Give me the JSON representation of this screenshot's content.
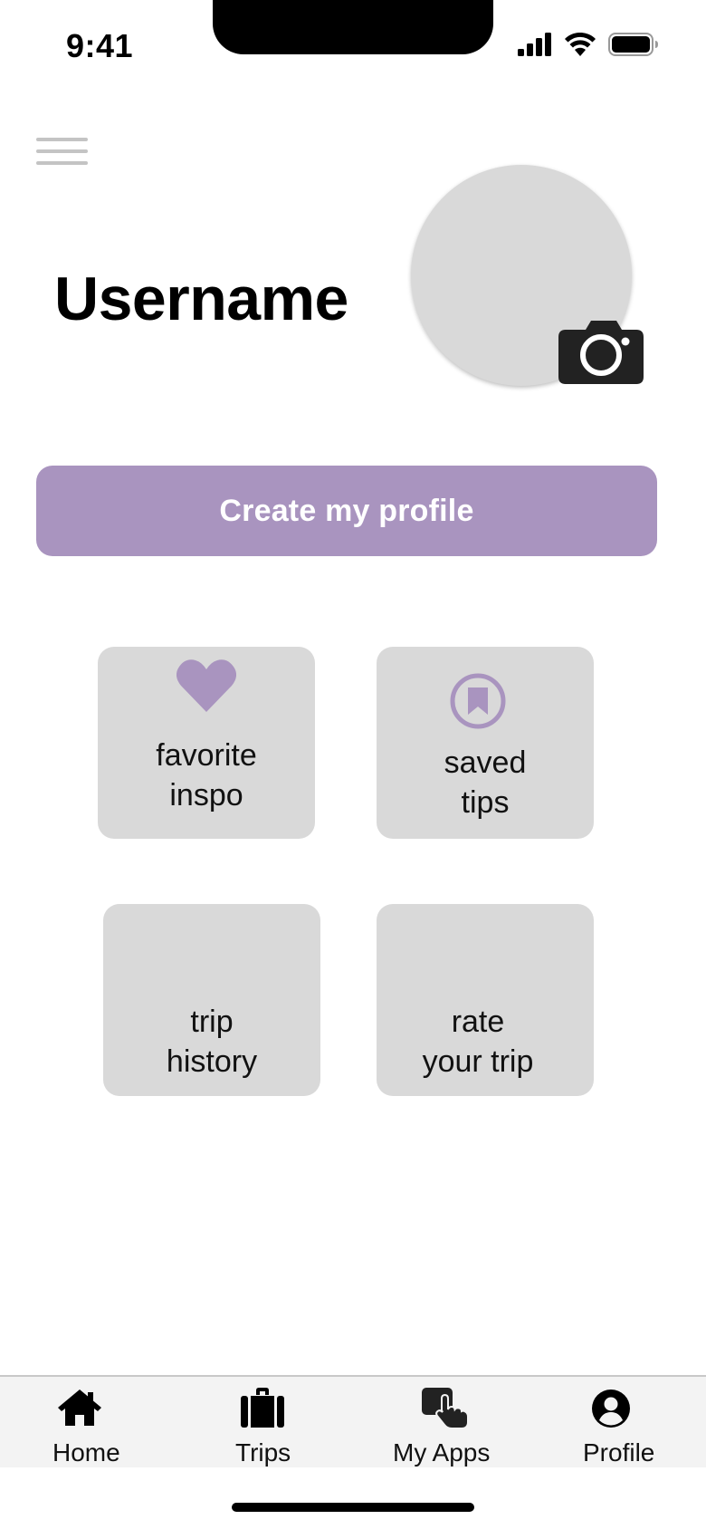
{
  "status_bar": {
    "time": "9:41"
  },
  "header": {
    "username": "Username"
  },
  "actions": {
    "create_profile_label": "Create my profile"
  },
  "tiles": [
    {
      "line1": "favorite",
      "line2": "inspo",
      "icon": "heart-icon"
    },
    {
      "line1": "saved",
      "line2": "tips",
      "icon": "bookmark-icon"
    },
    {
      "line1": "trip",
      "line2": "history",
      "icon": ""
    },
    {
      "line1": "rate",
      "line2": "your trip",
      "icon": ""
    }
  ],
  "tab_bar": {
    "items": [
      {
        "label": "Home",
        "icon": "home-icon"
      },
      {
        "label": "Trips",
        "icon": "briefcase-icon"
      },
      {
        "label": "My Apps",
        "icon": "hand-pointer-icon"
      },
      {
        "label": "Profile",
        "icon": "user-circle-icon"
      }
    ]
  },
  "colors": {
    "accent": "#a994bf",
    "tile_bg": "#d9d9d9",
    "tab_bar_bg": "#f3f3f3"
  }
}
